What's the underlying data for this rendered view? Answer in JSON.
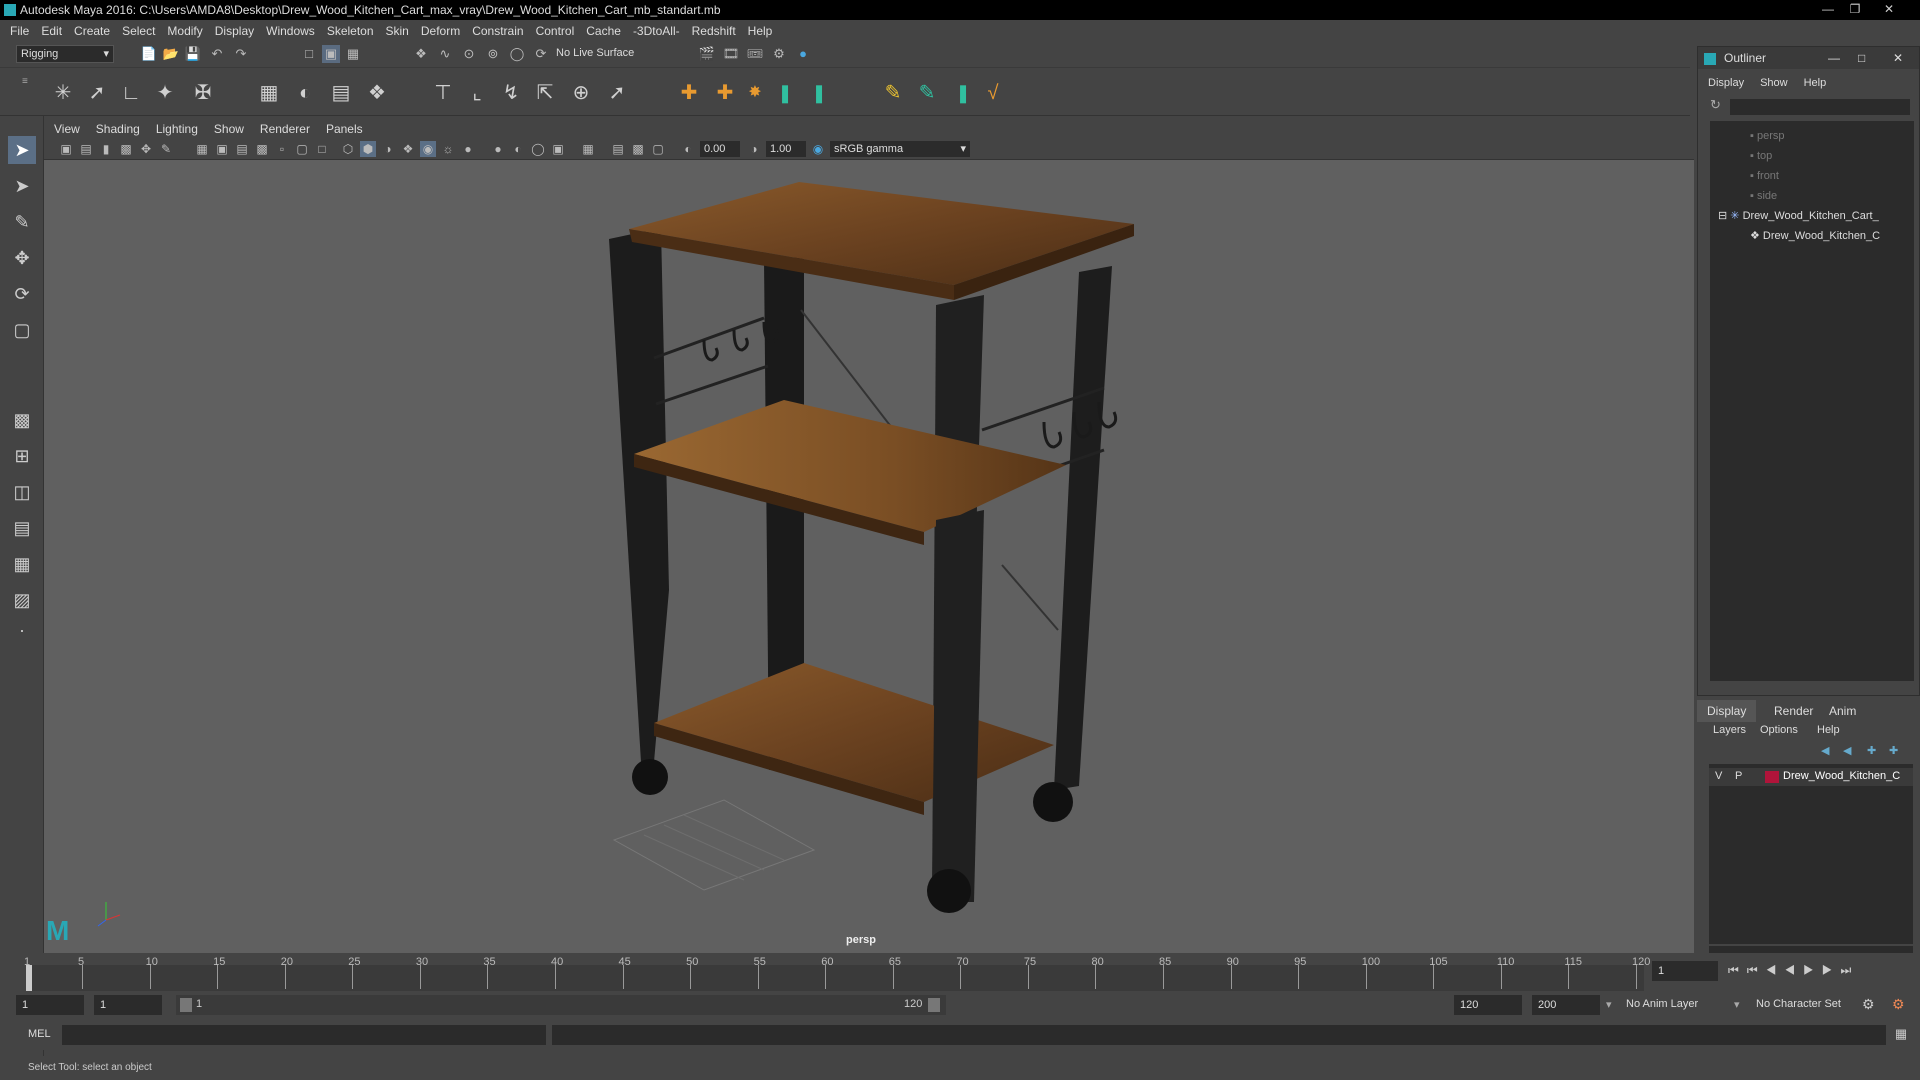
{
  "title": "Autodesk Maya 2016: C:\\Users\\AMDA8\\Desktop\\Drew_Wood_Kitchen_Cart_max_vray\\Drew_Wood_Kitchen_Cart_mb_standart.mb",
  "menu": [
    "File",
    "Edit",
    "Create",
    "Select",
    "Modify",
    "Display",
    "Windows",
    "Skeleton",
    "Skin",
    "Deform",
    "Constrain",
    "Control",
    "Cache",
    "-3DtoAll-",
    "Redshift",
    "Help"
  ],
  "status": {
    "mode": "Rigging",
    "live_surface": "No Live Surface"
  },
  "panel_menu": [
    "View",
    "Shading",
    "Lighting",
    "Show",
    "Renderer",
    "Panels"
  ],
  "panel_tools": {
    "near": "0.00",
    "far": "1.00",
    "color_space": "sRGB gamma"
  },
  "viewport": {
    "camera": "persp"
  },
  "outliner": {
    "title": "Outliner",
    "menu": [
      "Display",
      "Show",
      "Help"
    ],
    "items": [
      {
        "label": "persp",
        "dim": true
      },
      {
        "label": "top",
        "dim": true
      },
      {
        "label": "front",
        "dim": true
      },
      {
        "label": "side",
        "dim": true
      },
      {
        "label": "Drew_Wood_Kitchen_Cart_",
        "dim": false
      },
      {
        "label": "Drew_Wood_Kitchen_C",
        "dim": false
      }
    ]
  },
  "layers": {
    "tabs": [
      "Display",
      "Render",
      "Anim"
    ],
    "menu": [
      "Layers",
      "Options",
      "Help"
    ],
    "row": {
      "v": "V",
      "p": "P",
      "name": "Drew_Wood_Kitchen_C",
      "color": "#b0143a"
    }
  },
  "timeline": {
    "ticks": [
      "1",
      "5",
      "10",
      "15",
      "20",
      "25",
      "30",
      "35",
      "40",
      "45",
      "50",
      "55",
      "60",
      "65",
      "70",
      "75",
      "80",
      "85",
      "90",
      "95",
      "100",
      "105",
      "110",
      "115",
      "120"
    ],
    "current": "1"
  },
  "range": {
    "start": "1",
    "start2": "1",
    "slider_start": "1",
    "slider_end": "120",
    "end": "120",
    "end2": "200",
    "anim_layer": "No Anim Layer",
    "char_set": "No Character Set"
  },
  "cmd": {
    "label": "MEL"
  },
  "helpline": "Select Tool: select an object"
}
